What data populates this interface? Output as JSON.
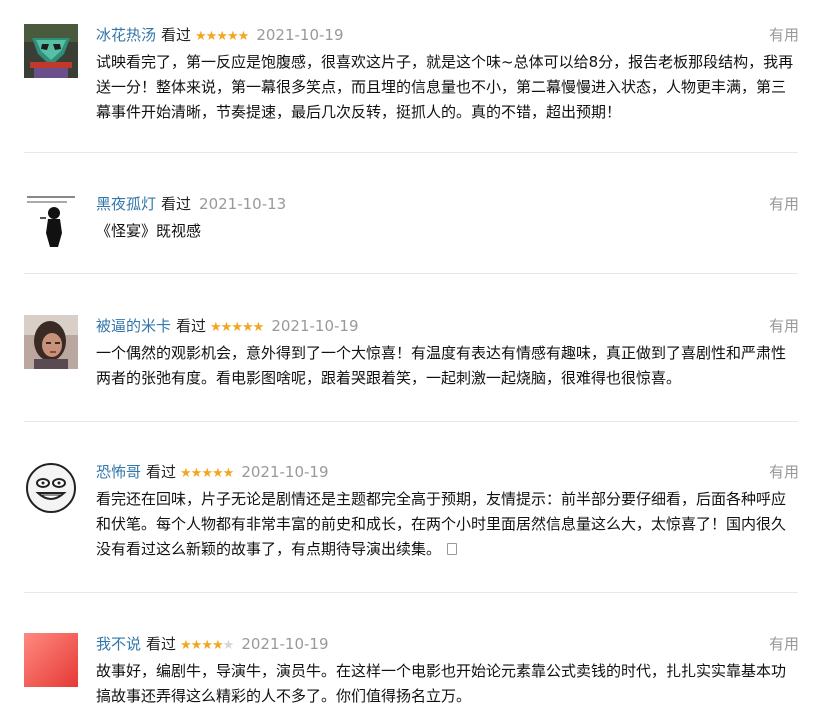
{
  "reviews": [
    {
      "author": "冰花热汤",
      "status": "看过",
      "rating": 5,
      "date": "2021-10-19",
      "useful_label": "有用",
      "content": "试映看完了，第一反应是饱腹感，很喜欢这片子，就是这个味~总体可以给8分，报告老板那段结构，我再送一分！整体来说，第一幕很多笑点，而且埋的信息量也不小，第二幕慢慢进入状态，人物更丰满，第三幕事件开始清晰，节奏提速，最后几次反转，挺抓人的。真的不错，超出预期！",
      "avatar_icon": "green-mask-avatar"
    },
    {
      "author": "黑夜孤灯",
      "status": "看过",
      "rating": null,
      "date": "2021-10-13",
      "useful_label": "有用",
      "content": "《怪宴》既视感",
      "avatar_icon": "comic-figure-avatar"
    },
    {
      "author": "被逼的米卡",
      "status": "看过",
      "rating": 5,
      "date": "2021-10-19",
      "useful_label": "有用",
      "content": "一个偶然的观影机会，意外得到了一个大惊喜！有温度有表达有情感有趣味，真正做到了喜剧性和严肃性两者的张弛有度。看电影图啥呢，跟着哭跟着笑，一起刺激一起烧脑，很难得也很惊喜。",
      "avatar_icon": "portrait-photo-avatar"
    },
    {
      "author": "恐怖哥",
      "status": "看过",
      "rating": 5,
      "date": "2021-10-19",
      "useful_label": "有用",
      "content": "看完还在回味，片子无论是剧情还是主题都完全高于预期，友情提示：前半部分要仔细看，后面各种呼应和伏笔。每个人物都有非常丰富的前史和成长，在两个小时里面居然信息量这么大，太惊喜了！国内很久没有看过这么新颖的故事了，有点期待导演出续集。",
      "avatar_icon": "meme-face-avatar"
    },
    {
      "author": "我不说",
      "status": "看过",
      "rating": 4,
      "date": "2021-10-19",
      "useful_label": "有用",
      "content": "故事好，编剧牛，导演牛，演员牛。在这样一个电影也开始论元素靠公式卖钱的时代，扎扎实实靠基本功搞故事还弄得这么精彩的人不多了。你们值得扬名立万。",
      "avatar_icon": "red-square-avatar"
    }
  ],
  "colors": {
    "author": "#3377aa",
    "star": "#f4a623",
    "muted": "#999999"
  }
}
